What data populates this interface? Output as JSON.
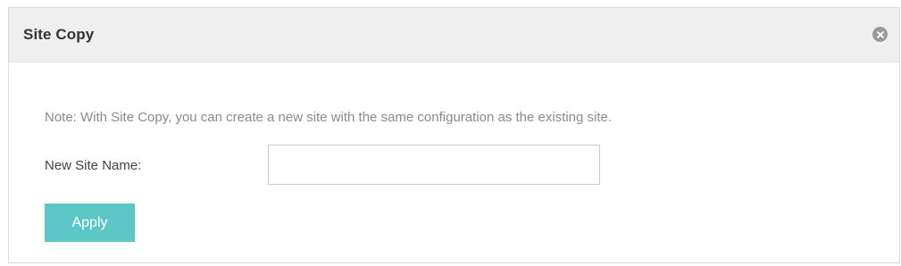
{
  "dialog": {
    "title": "Site Copy",
    "close_icon": "close-icon"
  },
  "form": {
    "note": "Note: With Site Copy, you can create a new site with the same configuration as the existing site.",
    "new_site_name_label": "New Site Name:",
    "new_site_name_value": "",
    "apply_label": "Apply"
  },
  "colors": {
    "titlebar_bg": "#efefef",
    "apply_button_bg": "#5cc7c4",
    "close_icon_bg": "#9a9a9a"
  }
}
